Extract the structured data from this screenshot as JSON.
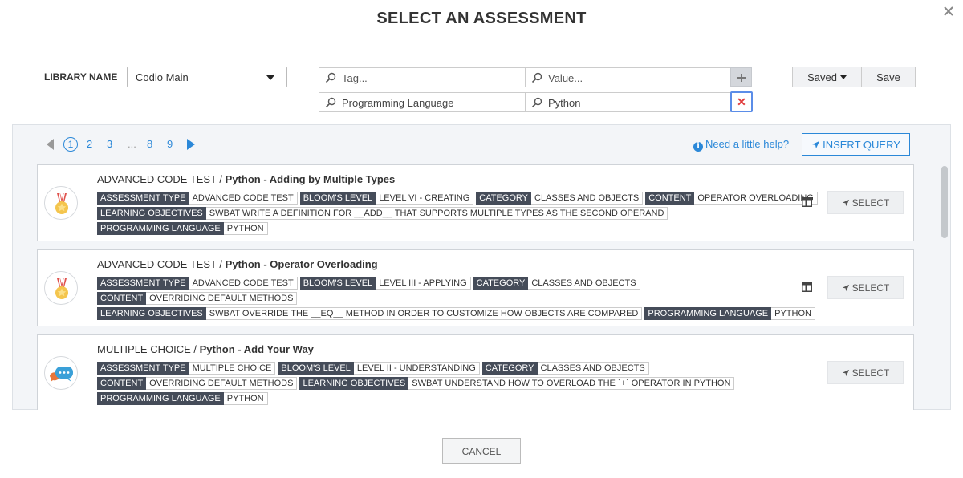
{
  "modal": {
    "title": "SELECT AN ASSESSMENT",
    "close_icon": "close-icon"
  },
  "library": {
    "label": "LIBRARY NAME",
    "value": "Codio Main"
  },
  "query": {
    "rows": [
      {
        "tag": "Tag...",
        "value": "Value..."
      },
      {
        "tag": "Programming Language",
        "value": "Python"
      }
    ],
    "remove_color": "#e03a3a",
    "accent": "#2b88d8"
  },
  "saved_label": "Saved",
  "save_label": "Save",
  "pagination": {
    "pages": [
      "1",
      "2",
      "3",
      "...",
      "8",
      "9"
    ],
    "current": "1"
  },
  "help": {
    "icon": "i",
    "label": "Need a little help?"
  },
  "insert_query_label": "INSERT QUERY",
  "cards": [
    {
      "type": "ADVANCED CODE TEST",
      "sep": " / ",
      "name": "Python - Adding by Multiple Types",
      "icon": "medal-icon",
      "lines": [
        [
          [
            "ASSESSMENT TYPE",
            "ADVANCED CODE TEST"
          ],
          [
            "BLOOM'S LEVEL",
            "LEVEL VI - CREATING"
          ],
          [
            "CATEGORY",
            "CLASSES AND OBJECTS"
          ],
          [
            "CONTENT",
            "OPERATOR OVERLOADING"
          ]
        ],
        [
          [
            "LEARNING OBJECTIVES",
            "SWBAT WRITE A DEFINITION FOR __ADD__ THAT SUPPORTS MULTIPLE TYPES AS THE SECOND OPERAND"
          ]
        ],
        [
          [
            "PROGRAMMING LANGUAGE",
            "PYTHON"
          ]
        ]
      ],
      "has_preview": true,
      "select_label": "SELECT"
    },
    {
      "type": "ADVANCED CODE TEST",
      "sep": " / ",
      "name": "Python - Operator Overloading",
      "icon": "medal-icon",
      "lines": [
        [
          [
            "ASSESSMENT TYPE",
            "ADVANCED CODE TEST"
          ],
          [
            "BLOOM'S LEVEL",
            "LEVEL III - APPLYING"
          ],
          [
            "CATEGORY",
            "CLASSES AND OBJECTS"
          ]
        ],
        [
          [
            "CONTENT",
            "OVERRIDING DEFAULT METHODS"
          ]
        ],
        [
          [
            "LEARNING OBJECTIVES",
            "SWBAT OVERRIDE THE __EQ__ METHOD IN ORDER TO CUSTOMIZE HOW OBJECTS ARE COMPARED"
          ],
          [
            "PROGRAMMING LANGUAGE",
            "PYTHON"
          ]
        ]
      ],
      "has_preview": true,
      "select_label": "SELECT"
    },
    {
      "type": "MULTIPLE CHOICE",
      "sep": " / ",
      "name": "Python - Add Your Way",
      "icon": "chat-bubbles-icon",
      "lines": [
        [
          [
            "ASSESSMENT TYPE",
            "MULTIPLE CHOICE"
          ],
          [
            "BLOOM'S LEVEL",
            "LEVEL II - UNDERSTANDING"
          ],
          [
            "CATEGORY",
            "CLASSES AND OBJECTS"
          ]
        ],
        [
          [
            "CONTENT",
            "OVERRIDING DEFAULT METHODS"
          ],
          [
            "LEARNING OBJECTIVES",
            "SWBAT UNDERSTAND HOW TO OVERLOAD THE `+` OPERATOR IN PYTHON"
          ]
        ],
        [
          [
            "PROGRAMMING LANGUAGE",
            "PYTHON"
          ]
        ]
      ],
      "has_preview": false,
      "select_label": "SELECT"
    }
  ],
  "cancel_label": "CANCEL"
}
